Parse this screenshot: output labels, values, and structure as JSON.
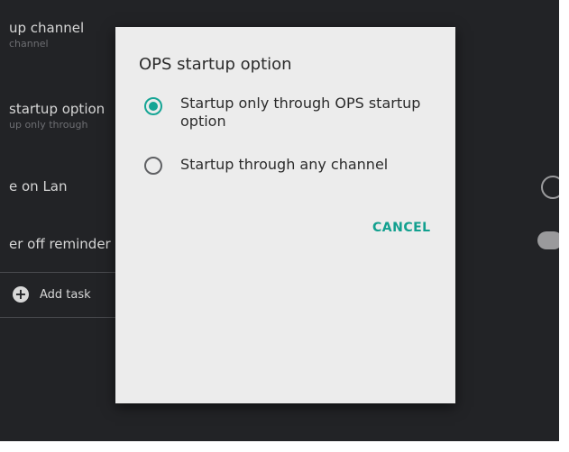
{
  "background_settings": {
    "items": [
      {
        "title": "up channel",
        "subtitle": "channel"
      },
      {
        "title": "startup option",
        "subtitle": "up only through"
      },
      {
        "title": "e on Lan",
        "subtitle": ""
      },
      {
        "title": "er off reminder",
        "subtitle": ""
      }
    ],
    "add_task_label": "Add task",
    "add_icon_glyph": "+"
  },
  "dialog": {
    "title": "OPS startup option",
    "options": [
      {
        "label": "Startup only through OPS startup option",
        "selected": true
      },
      {
        "label": "Startup through any channel",
        "selected": false
      }
    ],
    "cancel_label": "CANCEL"
  },
  "colors": {
    "accent": "#15a595",
    "background": "#222326",
    "dialog": "#ececec"
  }
}
